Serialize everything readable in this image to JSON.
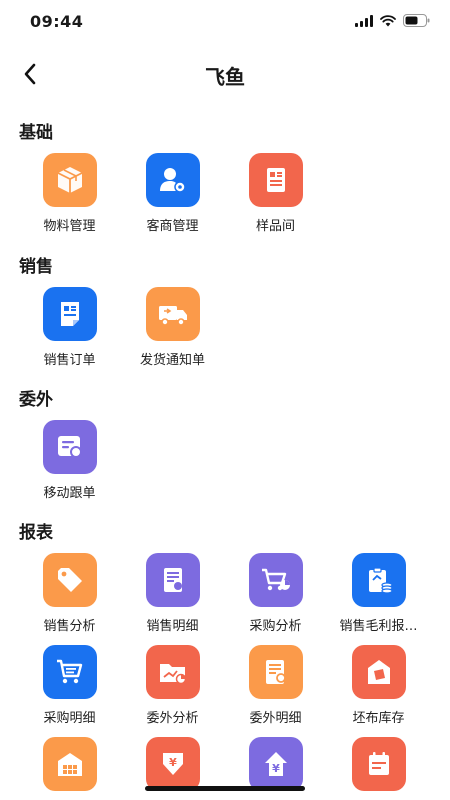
{
  "status": {
    "time": "09:44"
  },
  "nav": {
    "title": "飞鱼"
  },
  "sections": {
    "basic": {
      "title": "基础",
      "items": [
        {
          "label": "物料管理",
          "icon": "box-icon",
          "color": "#fb9a4a"
        },
        {
          "label": "客商管理",
          "icon": "user-gear-icon",
          "color": "#1a72f0"
        },
        {
          "label": "样品间",
          "icon": "document-icon",
          "color": "#f2664c"
        }
      ]
    },
    "sales": {
      "title": "销售",
      "items": [
        {
          "label": "销售订单",
          "icon": "order-icon",
          "color": "#1a72f0"
        },
        {
          "label": "发货通知单",
          "icon": "truck-icon",
          "color": "#fb9a4a"
        }
      ]
    },
    "outsource": {
      "title": "委外",
      "items": [
        {
          "label": "移动跟单",
          "icon": "track-icon",
          "color": "#7d6be0"
        }
      ]
    },
    "reports": {
      "title": "报表",
      "items": [
        {
          "label": "销售分析",
          "icon": "tag-icon",
          "color": "#fb9a4a"
        },
        {
          "label": "销售明细",
          "icon": "sales-detail-icon",
          "color": "#7d6be0"
        },
        {
          "label": "采购分析",
          "icon": "cart-chart-icon",
          "color": "#7d6be0"
        },
        {
          "label": "销售毛利报…",
          "icon": "clipboard-coins-icon",
          "color": "#1a72f0"
        },
        {
          "label": "采购明细",
          "icon": "cart-list-icon",
          "color": "#1a72f0"
        },
        {
          "label": "委外分析",
          "icon": "folder-chart-icon",
          "color": "#f2664c"
        },
        {
          "label": "委外明细",
          "icon": "doc-search-icon",
          "color": "#fb9a4a"
        },
        {
          "label": "坯布库存",
          "icon": "warehouse-icon",
          "color": "#f2664c"
        },
        {
          "label": "",
          "icon": "building-icon",
          "color": "#fb9a4a"
        },
        {
          "label": "",
          "icon": "yuan-down-icon",
          "color": "#f2664c"
        },
        {
          "label": "",
          "icon": "yuan-up-icon",
          "color": "#7d6be0"
        },
        {
          "label": "",
          "icon": "calendar-icon",
          "color": "#f2664c"
        }
      ]
    }
  }
}
